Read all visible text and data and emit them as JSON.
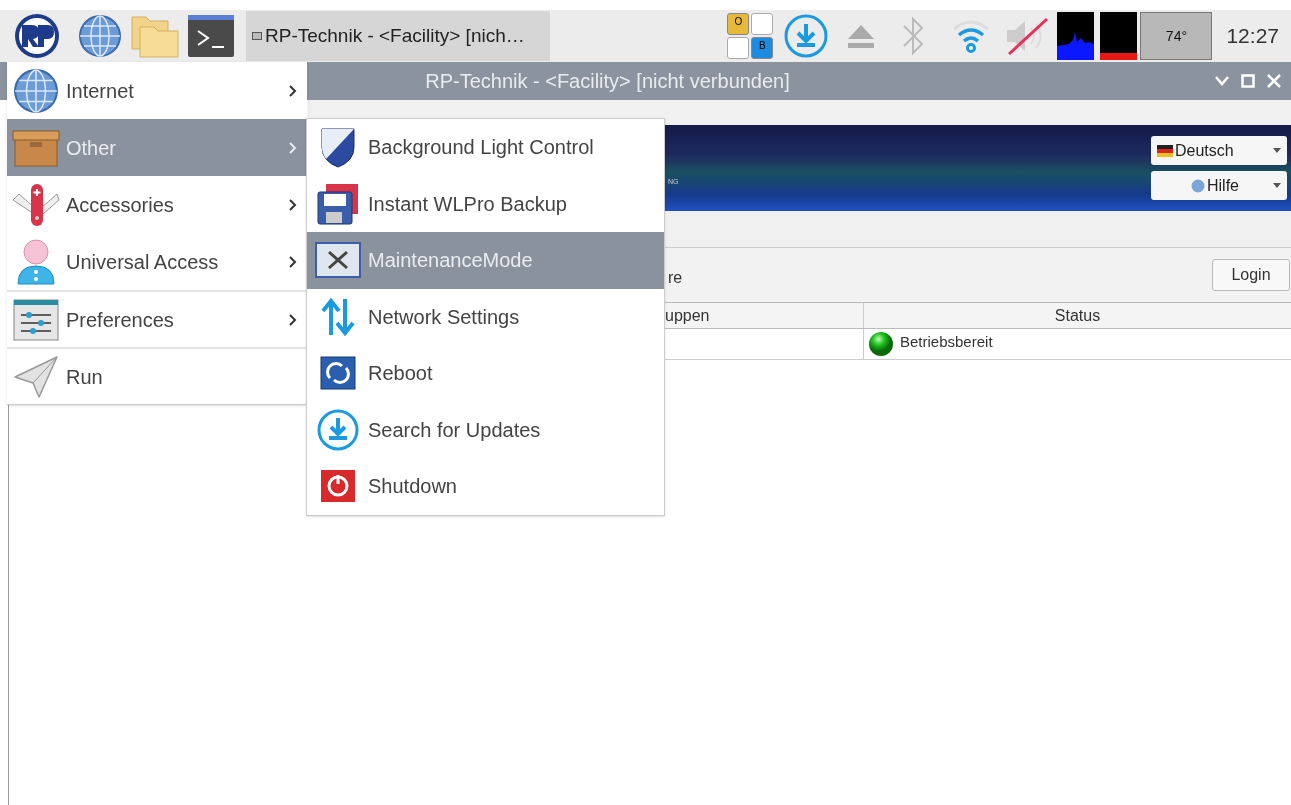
{
  "panel": {
    "taskbar_button": {
      "title": "RP-Technik - <Facility> [nich…",
      "selected": true
    },
    "keyboard_indicator": [
      "O",
      "B"
    ],
    "temperature": "74°",
    "clock": "12:27"
  },
  "window": {
    "title": "RP-Technik - <Facility> [nicht verbunden]"
  },
  "app": {
    "banner_text": "NG",
    "language": "Deutsch",
    "help": "Hilfe",
    "toolbar_text": "re",
    "login": "Login",
    "table": {
      "columns": [
        "uppen",
        "Status"
      ],
      "rows": [
        {
          "status": "Betriebsbereit"
        }
      ]
    }
  },
  "menu": {
    "items": [
      {
        "label": "Internet",
        "selected": false,
        "submenu": true,
        "divider_above": false
      },
      {
        "label": "Other",
        "selected": true,
        "submenu": true,
        "divider_above": false
      },
      {
        "label": "Accessories",
        "selected": false,
        "submenu": true,
        "divider_above": false
      },
      {
        "label": "Universal Access",
        "selected": false,
        "submenu": true,
        "divider_above": false
      },
      {
        "label": "Preferences",
        "selected": false,
        "submenu": true,
        "divider_above": true
      },
      {
        "label": "Run",
        "selected": false,
        "submenu": false,
        "divider_above": true
      }
    ]
  },
  "submenu": {
    "items": [
      {
        "label": "Background Light Control",
        "selected": false
      },
      {
        "label": "Instant WLPro Backup",
        "selected": false
      },
      {
        "label": "MaintenanceMode",
        "selected": true
      },
      {
        "label": "Network Settings",
        "selected": false
      },
      {
        "label": "Reboot",
        "selected": false
      },
      {
        "label": "Search for Updates",
        "selected": false
      },
      {
        "label": "Shutdown",
        "selected": false
      }
    ]
  }
}
